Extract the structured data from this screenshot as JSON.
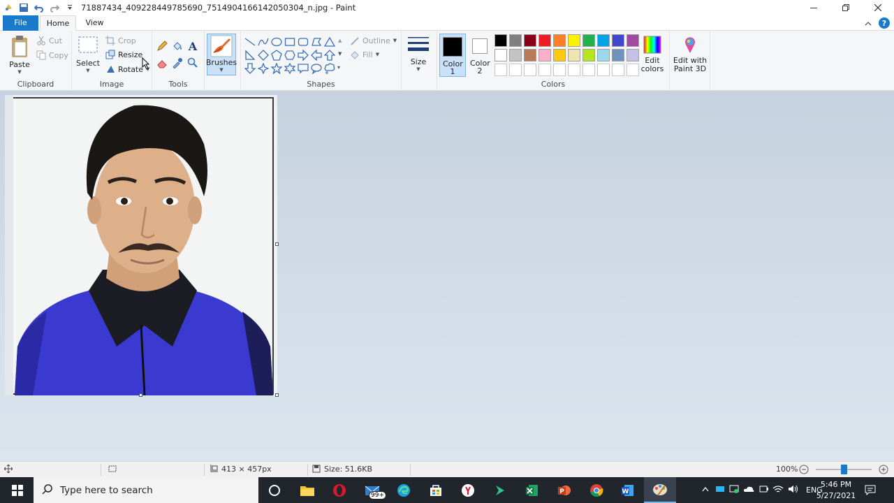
{
  "window": {
    "title": "71887434_409228449785690_7514904166142050304_n.jpg - Paint"
  },
  "tabs": {
    "file": "File",
    "home": "Home",
    "view": "View"
  },
  "ribbon": {
    "clipboard": {
      "label": "Clipboard",
      "paste": "Paste",
      "cut": "Cut",
      "copy": "Copy"
    },
    "image": {
      "label": "Image",
      "select": "Select",
      "crop": "Crop",
      "resize": "Resize",
      "rotate": "Rotate"
    },
    "tools": {
      "label": "Tools"
    },
    "brushes": {
      "label": "Brushes"
    },
    "shapes": {
      "label": "Shapes",
      "outline": "Outline",
      "fill": "Fill"
    },
    "size": {
      "label": "Size"
    },
    "colors": {
      "label": "Colors",
      "color1": "Color 1",
      "color2": "Color 2",
      "edit_colors": "Edit colors",
      "edit_paint3d": "Edit with Paint 3D",
      "color1_value": "#000000",
      "color2_value": "#ffffff",
      "palette_row1": [
        "#000000",
        "#7f7f7f",
        "#880015",
        "#ed1c24",
        "#ff7f27",
        "#fff200",
        "#22b14c",
        "#00a2e8",
        "#3f48cc",
        "#a349a4"
      ],
      "palette_row2": [
        "#ffffff",
        "#c3c3c3",
        "#b97a57",
        "#ffaec9",
        "#ffc90e",
        "#efe4b0",
        "#b5e61d",
        "#99d9ea",
        "#7092be",
        "#c8bfe7"
      ]
    }
  },
  "status": {
    "dimensions": "413 × 457px",
    "size": "Size: 51.6KB",
    "zoom": "100%"
  },
  "taskbar": {
    "search_placeholder": "Type here to search",
    "mail_badge": "99+",
    "time": "5:46 PM",
    "date": "5/27/2021",
    "language": "ENG"
  }
}
